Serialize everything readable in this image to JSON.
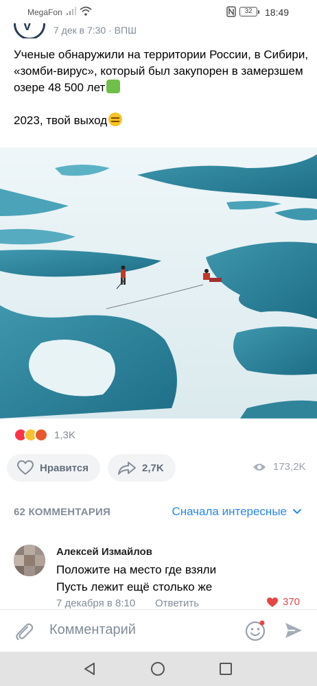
{
  "status": {
    "carrier": "MegaFon",
    "battery": "32",
    "time": "18:49"
  },
  "post": {
    "meta": "7 дек в 7:30 · ВПШ",
    "text_line1": "Ученые обнаружили на территории России, в Сибири, «зомби-вирус», который был закупорен в замерзшем озере 48 500 лет",
    "text_line2": "2023, твой выход",
    "emoji1": "zombie-emoji",
    "emoji2": "expressionless-face-emoji",
    "photo_description_icon": "arctic-ice-photo"
  },
  "reactions": {
    "icons": [
      "heart-reaction-icon",
      "laugh-reaction-icon",
      "angry-reaction-icon"
    ],
    "count": "1,3K"
  },
  "actions": {
    "like_label": "Нравится",
    "share_count": "2,7K",
    "views_count": "173,2K"
  },
  "comments": {
    "count_label": "62 КОММЕНТАРИЯ",
    "sort_label": "Сначала интересные",
    "items": [
      {
        "author": "Алексей Измайлов",
        "line1": "Положите на место где взяли",
        "line2": "Пусть лежит ещё столько же",
        "date": "7 декабря в 8:10",
        "reply_label": "Ответить",
        "likes": "370"
      }
    ]
  },
  "composer": {
    "placeholder": "Комментарий"
  },
  "colors": {
    "accent": "#2688eb",
    "like_red": "#e64646",
    "secondary_text": "#818c99",
    "button_bg": "#f2f3f5"
  }
}
